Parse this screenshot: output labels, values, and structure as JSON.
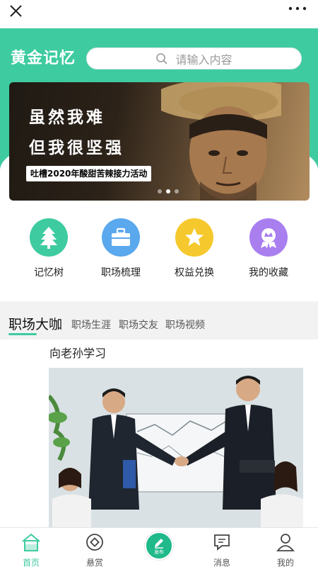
{
  "app": {
    "brand": "黄金记忆",
    "search_placeholder": "请输入内容"
  },
  "banner": {
    "line1": "虽然我难",
    "line2": "但我很坚强",
    "tag": "吐槽2020年酸甜苦辣接力活动",
    "dots_total": 3,
    "dots_active": 1
  },
  "quick_actions": [
    {
      "label": "记忆树",
      "icon": "tree-icon",
      "color": "#3ecba0"
    },
    {
      "label": "职场梳理",
      "icon": "briefcase-icon",
      "color": "#5aa8ee"
    },
    {
      "label": "权益兑换",
      "icon": "star-icon",
      "color": "#f5c92d"
    },
    {
      "label": "我的收藏",
      "icon": "ribbon-badge-icon",
      "color": "#a97ff0"
    }
  ],
  "tabs": [
    {
      "label": "职场大咖",
      "active": true
    },
    {
      "label": "职场生涯",
      "active": false
    },
    {
      "label": "职场交友",
      "active": false
    },
    {
      "label": "职场视频",
      "active": false
    }
  ],
  "article": {
    "title": "向老孙学习"
  },
  "tabbar": {
    "items": [
      {
        "label": "首页",
        "icon": "home-icon",
        "active": true
      },
      {
        "label": "悬赏",
        "icon": "target-icon",
        "active": false
      },
      {
        "label": "发布",
        "icon": "pencil-icon",
        "active": false
      },
      {
        "label": "消息",
        "icon": "message-icon",
        "active": false
      },
      {
        "label": "我的",
        "icon": "user-icon",
        "active": false
      }
    ]
  },
  "colors": {
    "accent": "#3ecba0",
    "publish_bg": "#1fb98a"
  }
}
